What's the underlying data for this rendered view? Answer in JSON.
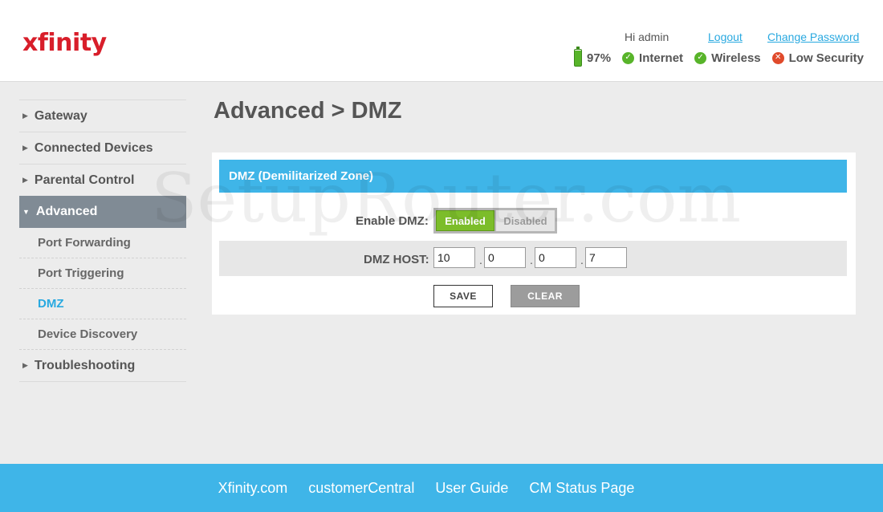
{
  "header": {
    "logo": "xfinity",
    "greeting": "Hi admin",
    "logout": "Logout",
    "change_password": "Change Password",
    "battery": "97%",
    "status": [
      {
        "label": "Internet",
        "state": "ok",
        "icon": "check-circle-icon"
      },
      {
        "label": "Wireless",
        "state": "ok",
        "icon": "check-circle-icon"
      },
      {
        "label": "Low Security",
        "state": "bad",
        "icon": "x-circle-icon"
      }
    ]
  },
  "sidebar": {
    "items": [
      {
        "label": "Gateway"
      },
      {
        "label": "Connected Devices"
      },
      {
        "label": "Parental Control"
      },
      {
        "label": "Advanced"
      },
      {
        "label": "Troubleshooting"
      }
    ],
    "sub_items": [
      {
        "label": "Port Forwarding"
      },
      {
        "label": "Port Triggering"
      },
      {
        "label": "DMZ"
      },
      {
        "label": "Device Discovery"
      }
    ]
  },
  "main": {
    "title": "Advanced > DMZ",
    "panel_title": "DMZ (Demilitarized Zone)",
    "enable_label": "Enable DMZ:",
    "enabled": "Enabled",
    "disabled": "Disabled",
    "host_label": "DMZ HOST:",
    "host": [
      "10",
      "0",
      "0",
      "7"
    ],
    "save": "SAVE",
    "clear": "CLEAR"
  },
  "watermark": "SetupRouter.com",
  "footer": {
    "links": [
      "Xfinity.com",
      "customerCentral",
      "User Guide",
      "CM Status Page"
    ]
  },
  "colors": {
    "brand_red": "#d81e2a",
    "accent_blue": "#3fb5e8",
    "link_blue": "#29a9e0",
    "enabled_green": "#7cbd2a",
    "status_green": "#58b42a",
    "status_red": "#e04a2b"
  }
}
